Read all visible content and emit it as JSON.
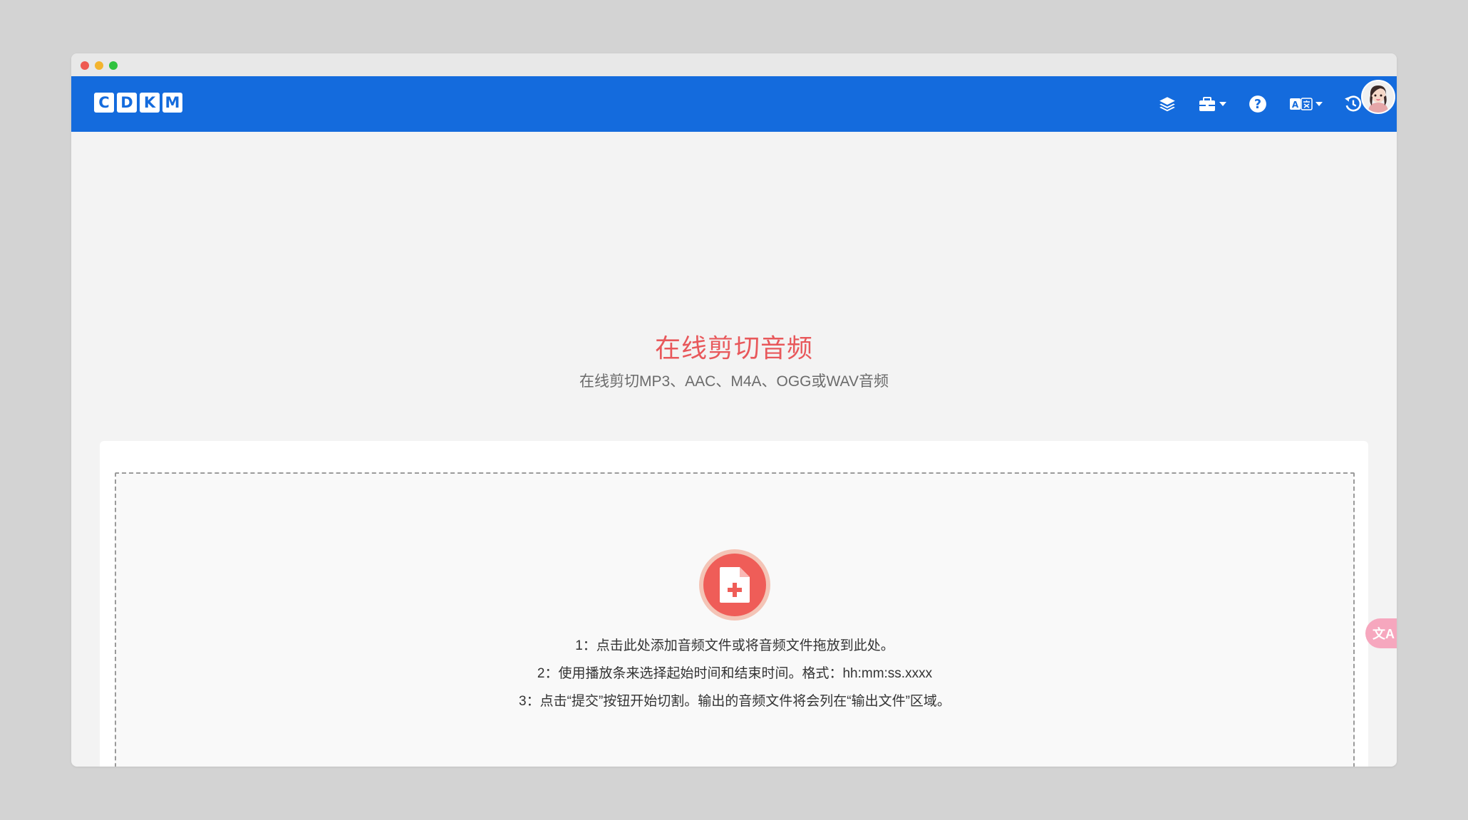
{
  "brand": {
    "logo_letters": [
      "C",
      "D",
      "K",
      "M"
    ]
  },
  "navbar": {
    "bg_color": "#146bdd",
    "icons": [
      "layers-icon",
      "toolbox-icon",
      "help-icon",
      "language-icon",
      "history-icon",
      "avatar"
    ]
  },
  "hero": {
    "title": "在线剪切音频",
    "subtitle": "在线剪切MP3、AAC、M4A、OGG或WAV音频",
    "title_color": "#e8585b"
  },
  "upload": {
    "icon": "file-add-icon",
    "steps": [
      "1：点击此处添加音频文件或将音频文件拖放到此处。",
      "2：使用播放条来选择起始时间和结束时间。格式：hh:mm:ss.xxxx",
      "3：点击“提交”按钮开始切割。输出的音频文件将会列在“输出文件”区域。"
    ]
  },
  "side_widget": {
    "label": "文A"
  }
}
